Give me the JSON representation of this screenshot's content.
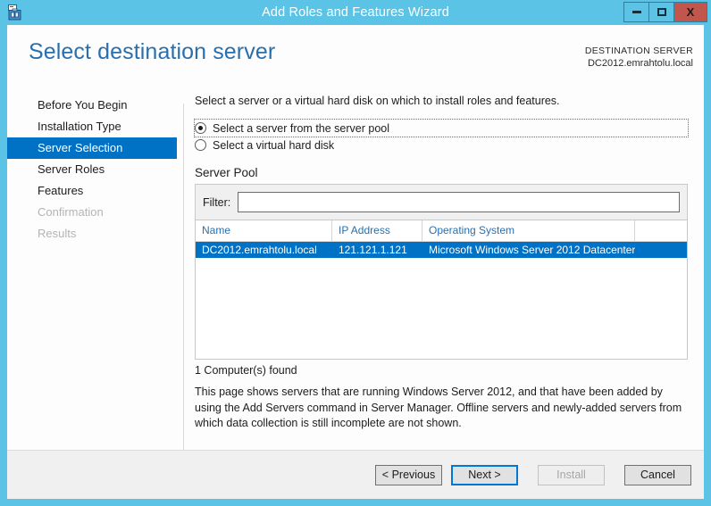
{
  "window": {
    "title": "Add Roles and Features Wizard",
    "icon": "server-manager-icon",
    "minimize_label": "Minimize",
    "maximize_label": "Maximize",
    "close_label": "X",
    "titlebar_color": "#5bc3e5",
    "close_button_color": "#c0564c",
    "accent_color": "#0072c6"
  },
  "header": {
    "page_title": "Select destination server",
    "destination_label": "DESTINATION SERVER",
    "destination_value": "DC2012.emrahtolu.local"
  },
  "sidebar": {
    "items": [
      {
        "label": "Before You Begin",
        "state": "normal"
      },
      {
        "label": "Installation Type",
        "state": "normal"
      },
      {
        "label": "Server Selection",
        "state": "selected"
      },
      {
        "label": "Server Roles",
        "state": "normal"
      },
      {
        "label": "Features",
        "state": "normal"
      },
      {
        "label": "Confirmation",
        "state": "disabled"
      },
      {
        "label": "Results",
        "state": "disabled"
      }
    ]
  },
  "main": {
    "intro": "Select a server or a virtual hard disk on which to install roles and features.",
    "radios": [
      {
        "label": "Select a server from the server pool",
        "checked": true,
        "focused": true
      },
      {
        "label": "Select a virtual hard disk",
        "checked": false,
        "focused": false
      }
    ],
    "server_pool_title": "Server Pool",
    "filter": {
      "label": "Filter:",
      "value": "",
      "placeholder": ""
    },
    "table": {
      "columns": [
        "Name",
        "IP Address",
        "Operating System",
        ""
      ],
      "rows": [
        {
          "selected": true,
          "cells": [
            "DC2012.emrahtolu.local",
            "121.121.1.121",
            "Microsoft Windows Server 2012 Datacenter",
            ""
          ]
        }
      ]
    },
    "found_text": "1 Computer(s) found",
    "description": "This page shows servers that are running Windows Server 2012, and that have been added by using the Add Servers command in Server Manager. Offline servers and newly-added servers from which data collection is still incomplete are not shown."
  },
  "footer": {
    "buttons": [
      {
        "label": "< Previous",
        "state": "normal"
      },
      {
        "label": "Next >",
        "state": "focused"
      },
      {
        "label": "Install",
        "state": "disabled"
      },
      {
        "label": "Cancel",
        "state": "normal"
      }
    ]
  }
}
